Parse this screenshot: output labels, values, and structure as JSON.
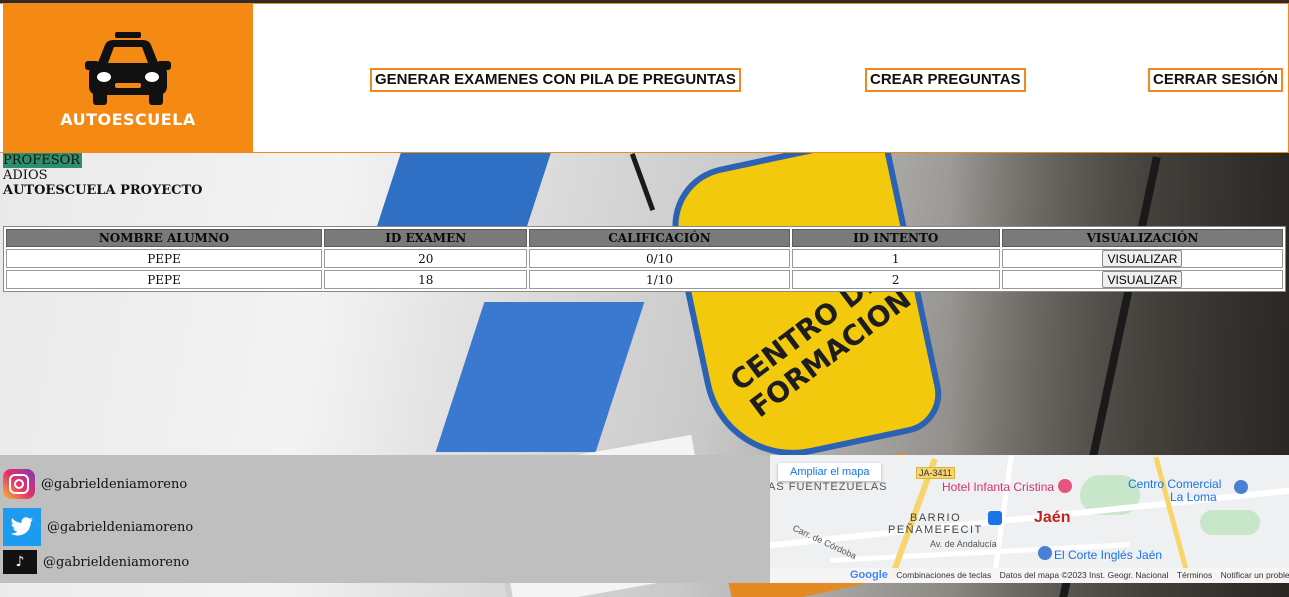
{
  "header": {
    "logo_text": "AUTOESCUELA",
    "nav": {
      "generar": "GENERAR EXAMENES CON PILA DE PREGUNTAS",
      "crear": "CREAR PREGUNTAS",
      "cerrar": "CERRAR SESIÓN"
    },
    "accent_color": "#f48a13"
  },
  "user": {
    "role": "PROFESOR",
    "name": "ADIOS",
    "school": "AUTOESCUELA PROYECTO"
  },
  "table": {
    "headers": [
      "NOMBRE ALUMNO",
      "ID EXAMEN",
      "CALIFICACIÓN",
      "ID INTENTO",
      "VISUALIZACIÓN"
    ],
    "rows": [
      {
        "alumno": "PEPE",
        "examen": "20",
        "calificacion": "0/10",
        "intento": "1",
        "accion": "VISUALIZAR"
      },
      {
        "alumno": "PEPE",
        "examen": "18",
        "calificacion": "1/10",
        "intento": "2",
        "accion": "VISUALIZAR"
      }
    ]
  },
  "footer": {
    "social": [
      {
        "network": "instagram-icon",
        "handle": "@gabrieldeniamoreno"
      },
      {
        "network": "twitter-icon",
        "handle": "@gabrieldeniamoreno"
      },
      {
        "network": "tiktok-icon",
        "handle": "@gabrieldeniamoreno"
      }
    ]
  },
  "map": {
    "ampliar": "Ampliar el mapa",
    "road_badge": "JA-3411",
    "labels": {
      "fuentezuelas": "AS FUENTEZUELAS",
      "hotel": "Hotel Infanta Cristina",
      "centro_comercial": "Centro Comercial",
      "la_loma": "La Loma",
      "barrio": "BARRIO",
      "penamefecit": "PEÑAMEFECIT",
      "jaen": "Jaén",
      "av_andalucia": "Av. de Andalucía",
      "carr_cordoba": "Carr. de Córdoba",
      "corte_ingles": "El Corte Inglés Jaén"
    },
    "attribution": {
      "google": "Google",
      "shortcuts": "Combinaciones de teclas",
      "data": "Datos del mapa ©2023 Inst. Geogr. Nacional",
      "terms": "Términos",
      "report": "Notificar un problema de Maps"
    }
  }
}
